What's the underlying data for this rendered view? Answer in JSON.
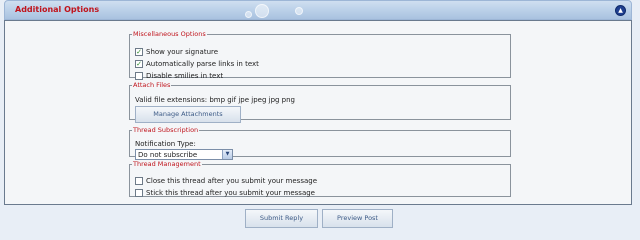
{
  "header": {
    "title": "Additional Options",
    "collapse_icon": "collapse-up-icon"
  },
  "misc": {
    "legend": "Miscellaneous Options",
    "items": [
      {
        "label": "Show your signature",
        "checked": true
      },
      {
        "label": "Automatically parse links in text",
        "checked": true
      },
      {
        "label": "Disable smilies in text",
        "checked": false
      }
    ]
  },
  "attach": {
    "legend": "Attach Files",
    "extensions": "Valid file extensions: bmp gif jpe jpeg jpg png",
    "manage_label": "Manage Attachments"
  },
  "subscription": {
    "legend": "Thread Subscription",
    "label": "Notification Type:",
    "selected": "Do not subscribe"
  },
  "management": {
    "legend": "Thread Management",
    "items": [
      {
        "label": "Close this thread after you submit your message",
        "checked": false
      },
      {
        "label": "Stick this thread after you submit your message",
        "checked": false
      }
    ]
  },
  "footer": {
    "submit_label": "Submit Reply",
    "preview_label": "Preview Post"
  },
  "colors": {
    "legend": "#c0141c",
    "title": "#c0141c",
    "header_bg": "#b9cfe8"
  }
}
